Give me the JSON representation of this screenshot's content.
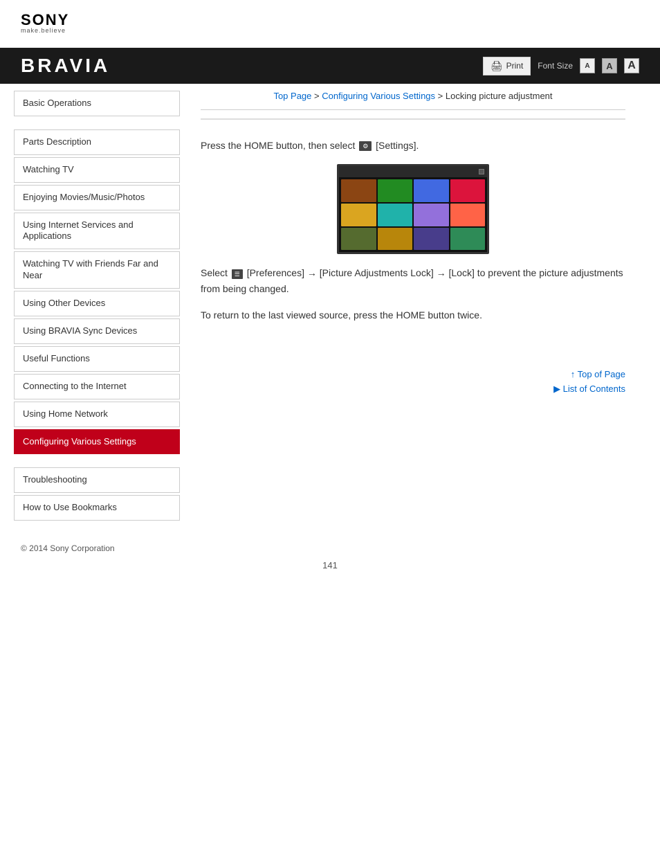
{
  "logo": {
    "brand": "SONY",
    "tagline": "make.believe"
  },
  "header": {
    "title": "BRAVIA",
    "print_label": "Print",
    "font_size_label": "Font Size",
    "font_small": "A",
    "font_medium": "A",
    "font_large": "A"
  },
  "breadcrumb": {
    "top": "Top Page",
    "section": "Configuring Various Settings",
    "current": "Locking picture adjustment"
  },
  "sidebar": {
    "items": [
      {
        "id": "basic-operations",
        "label": "Basic Operations",
        "active": false
      },
      {
        "id": "parts-description",
        "label": "Parts Description",
        "active": false
      },
      {
        "id": "watching-tv",
        "label": "Watching TV",
        "active": false
      },
      {
        "id": "enjoying-movies",
        "label": "Enjoying Movies/Music/Photos",
        "active": false
      },
      {
        "id": "internet-services",
        "label": "Using Internet Services and Applications",
        "active": false
      },
      {
        "id": "watching-friends",
        "label": "Watching TV with Friends Far and Near",
        "active": false
      },
      {
        "id": "other-devices",
        "label": "Using Other Devices",
        "active": false
      },
      {
        "id": "bravia-sync",
        "label": "Using BRAVIA Sync Devices",
        "active": false
      },
      {
        "id": "useful-functions",
        "label": "Useful Functions",
        "active": false
      },
      {
        "id": "connecting-internet",
        "label": "Connecting to the Internet",
        "active": false
      },
      {
        "id": "home-network",
        "label": "Using Home Network",
        "active": false
      },
      {
        "id": "configuring-settings",
        "label": "Configuring Various Settings",
        "active": true
      },
      {
        "id": "troubleshooting",
        "label": "Troubleshooting",
        "active": false
      },
      {
        "id": "how-to-bookmarks",
        "label": "How to Use Bookmarks",
        "active": false
      }
    ]
  },
  "content": {
    "step1": "Press the HOME button, then select  [Settings].",
    "step2": "Select  [Preferences] → [Picture Adjustments Lock] → [Lock] to prevent the picture adjustments from being changed.",
    "step3": "To return to the last viewed source, press the HOME button twice."
  },
  "footer": {
    "top_of_page": "Top of Page",
    "list_of_contents": "List of Contents"
  },
  "copyright": "© 2014 Sony Corporation",
  "page_number": "141"
}
